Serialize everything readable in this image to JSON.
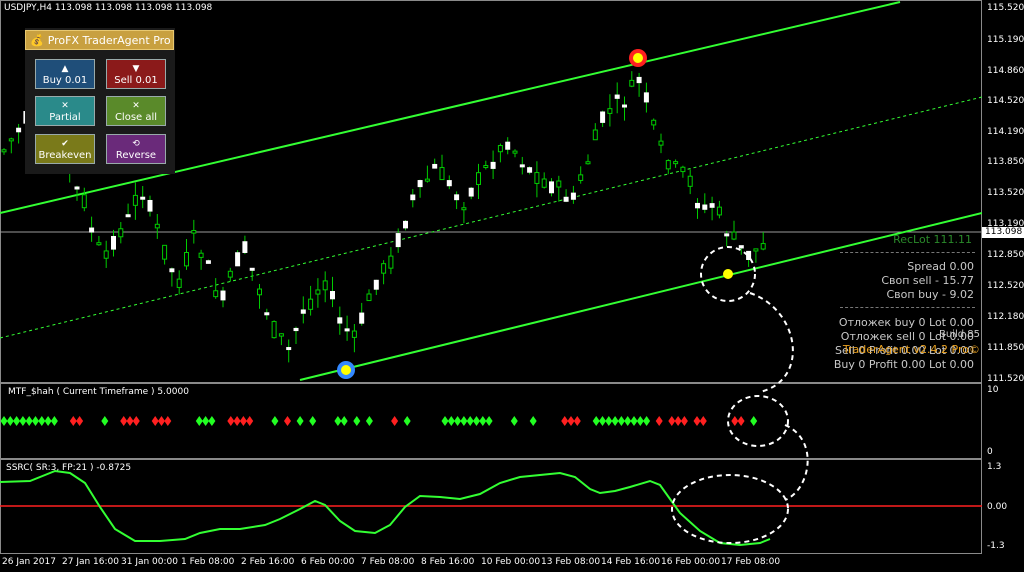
{
  "chart_header": {
    "title": "USDJPY,H4  113.098 113.098 113.098 113.098"
  },
  "price_axis": {
    "ticks": [
      "115.520",
      "115.190",
      "114.860",
      "114.520",
      "114.190",
      "113.850",
      "113.520",
      "113.190",
      "112.850",
      "112.520",
      "112.180",
      "111.850",
      "111.520"
    ],
    "current_price": "113.098"
  },
  "panel": {
    "title": "ProFX TraderAgent Pro",
    "buttons": [
      {
        "label": "Buy 0.01",
        "icon": "▲",
        "color": "#1f4e79"
      },
      {
        "label": "Sell 0.01",
        "icon": "▼",
        "color": "#8b1a1a"
      },
      {
        "label": "Partial",
        "icon": "✕",
        "color": "#2a8a8a"
      },
      {
        "label": "Close all",
        "icon": "✕",
        "color": "#5a8a2a"
      },
      {
        "label": "Breakeven",
        "icon": "✔",
        "color": "#7a7a1a"
      },
      {
        "label": "Reverse",
        "icon": "⟲",
        "color": "#6a2a7a"
      }
    ]
  },
  "info": {
    "reclot": "RecLot    111.11",
    "spread": "Spread    0.00",
    "own_sell": "Своп sell  - 15.77",
    "own_buy": "Своп buy  - 9.02",
    "pending_buy": "Отложек buy 0   Lot 0.00",
    "pending_sell": "Отложек sell 0   Lot 0.00",
    "build": "Build 85",
    "sell_line": "Sell 0  Profit 0.00  Lot 0.00",
    "agent": "TraderAgent v2.4.2 Pro©",
    "buy_line": "Buy 0  Profit 0.00  Lot 0.00"
  },
  "indicator1": {
    "title": "MTF_$hah ( Current Timeframe )  5.0000",
    "axis_top": "10",
    "axis_bottom": "0"
  },
  "indicator2": {
    "title": "SSRC( SR:3, FP:21 ) -0.8725",
    "axis_top": "1.3",
    "axis_mid": "0.00",
    "axis_bottom": "-1.3"
  },
  "time_axis": [
    "26 Jan 2017",
    "27 Jan 16:00",
    "31 Jan 00:00",
    "1 Feb 08:00",
    "2 Feb 16:00",
    "6 Feb 00:00",
    "7 Feb 08:00",
    "8 Feb 16:00",
    "10 Feb 00:00",
    "13 Feb 08:00",
    "14 Feb 16:00",
    "16 Feb 00:00",
    "17 Feb 08:00"
  ],
  "colors": {
    "bull": "#ffffff",
    "bear": "#00cc00",
    "channel": "#33ff33",
    "signal_red": "#ff2020",
    "signal_green": "#22ff22"
  }
}
